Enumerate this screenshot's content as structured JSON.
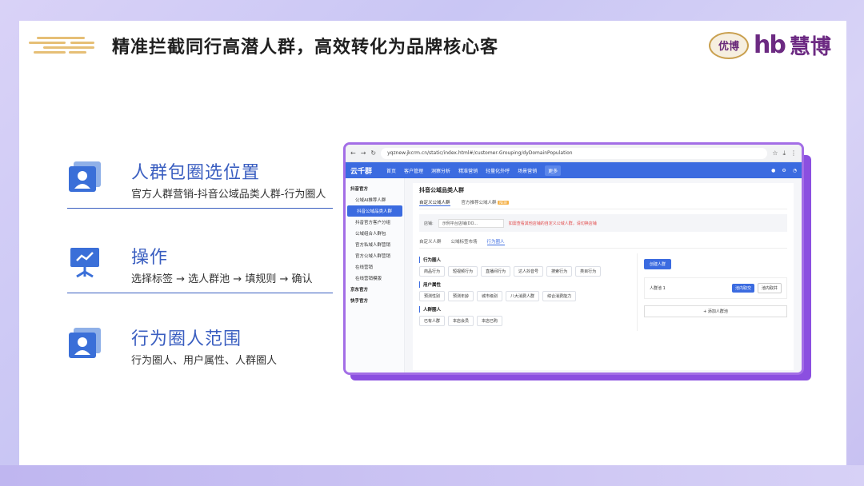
{
  "header": {
    "title": "精准拦截同行高潜人群，高效转化为品牌核心客",
    "logo_youbo": "优博",
    "logo_hb": "hb",
    "logo_huibo": "慧博"
  },
  "features": [
    {
      "icon": "user-card-icon",
      "title": "人群包圈选位置",
      "desc": "官方人群营销-抖音公域品类人群-行为圈人"
    },
    {
      "icon": "presentation-board-icon",
      "title": "操作",
      "desc": "选择标签 → 选人群池 → 填规则 → 确认"
    },
    {
      "icon": "user-card-icon",
      "title": "行为圈人范围",
      "desc": "行为圈人、用户属性、人群圈人"
    }
  ],
  "browser": {
    "url": "yqznew.jkcrm.cn/static/index.html#/customer-Grouping/dyDomainPopulation",
    "app_logo": "云千群",
    "nav_items": [
      "首页",
      "客户管理",
      "洞察分析",
      "精准营销",
      "轻量化外呼",
      "场景营销"
    ],
    "nav_more": "更多",
    "sidebar": [
      {
        "label": "抖音官方",
        "type": "group"
      },
      {
        "label": "公域AI推荐人群",
        "type": "sub"
      },
      {
        "label": "抖音公域品类人群",
        "type": "active"
      },
      {
        "label": "抖音官方客户分组",
        "type": "sub"
      },
      {
        "label": "公域组合人群包",
        "type": "sub"
      },
      {
        "label": "官方私域人群营销",
        "type": "sub"
      },
      {
        "label": "官方公域人群营销",
        "type": "sub"
      },
      {
        "label": "在线营销",
        "type": "sub"
      },
      {
        "label": "在线营销模版",
        "type": "sub"
      },
      {
        "label": "京东官方",
        "type": "group"
      },
      {
        "label": "快手官方",
        "type": "group"
      }
    ],
    "main_title": "抖音公域品类人群",
    "tabs": [
      "自定义公域人群",
      "官方推荐公域人群"
    ],
    "tab_new": "NEW",
    "store_label": "店铺:",
    "store_select": "示例平台店铺(DO...",
    "warn": "如需查看其他店铺的自定义公域人群，请切换店铺",
    "inner_tabs": [
      "自定义人群",
      "公域标签市场",
      "行为圈人"
    ],
    "sections": [
      {
        "title": "行为圈人",
        "chips": [
          "商品行为",
          "短视频行为",
          "直播间行为",
          "达人抖音号",
          "搜索行为",
          "类目行为"
        ]
      },
      {
        "title": "用户属性",
        "chips": [
          "预测性别",
          "预测年龄",
          "城市级别",
          "八大消费人群",
          "综合消费能力"
        ]
      },
      {
        "title": "人群圈人",
        "chips": [
          "已有人群",
          "本店会员",
          "本店已购"
        ]
      }
    ],
    "create_btn": "创建人群",
    "pool_label": "人群池 1",
    "pool_btn1": "池内取交",
    "pool_btn2": "池内取并",
    "add_pool": "+ 添加人群池"
  },
  "colors": {
    "accent": "#3a5ec0",
    "frame": "#a36ee6",
    "shadow": "#8b4fe0",
    "app_blue": "#3b6be0"
  }
}
